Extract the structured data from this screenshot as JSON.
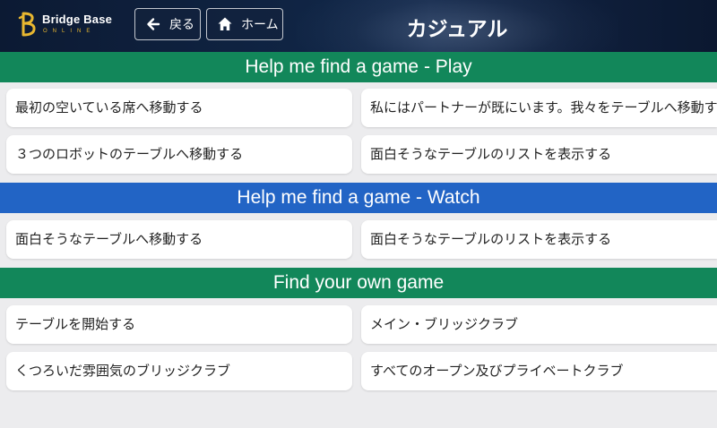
{
  "header": {
    "logo": {
      "name": "Bridge Base",
      "sub": "ONLINE"
    },
    "back_label": "戻る",
    "home_label": "ホーム",
    "title": "カジュアル"
  },
  "sections": [
    {
      "title": "Help me find a game - Play",
      "color": "#12875a",
      "items": [
        "最初の空いている席へ移動する",
        "私にはパートナーが既にいます。我々をテーブルへ移動する",
        "３つのロボットのテーブルへ移動する",
        "面白そうなテーブルのリストを表示する"
      ]
    },
    {
      "title": "Help me find a game - Watch",
      "color": "#2264c5",
      "items": [
        "面白そうなテーブルへ移動する",
        "面白そうなテーブルのリストを表示する"
      ]
    },
    {
      "title": "Find your own game",
      "color": "#12875a",
      "items": [
        "テーブルを開始する",
        "メイン・ブリッジクラブ",
        "くつろいだ雰囲気のブリッジクラブ",
        "すべてのオープン及びプライベートクラブ"
      ]
    }
  ],
  "icons": {
    "back": "arrow-left-icon",
    "home": "home-icon",
    "logo": "bbo-logo-icon"
  }
}
